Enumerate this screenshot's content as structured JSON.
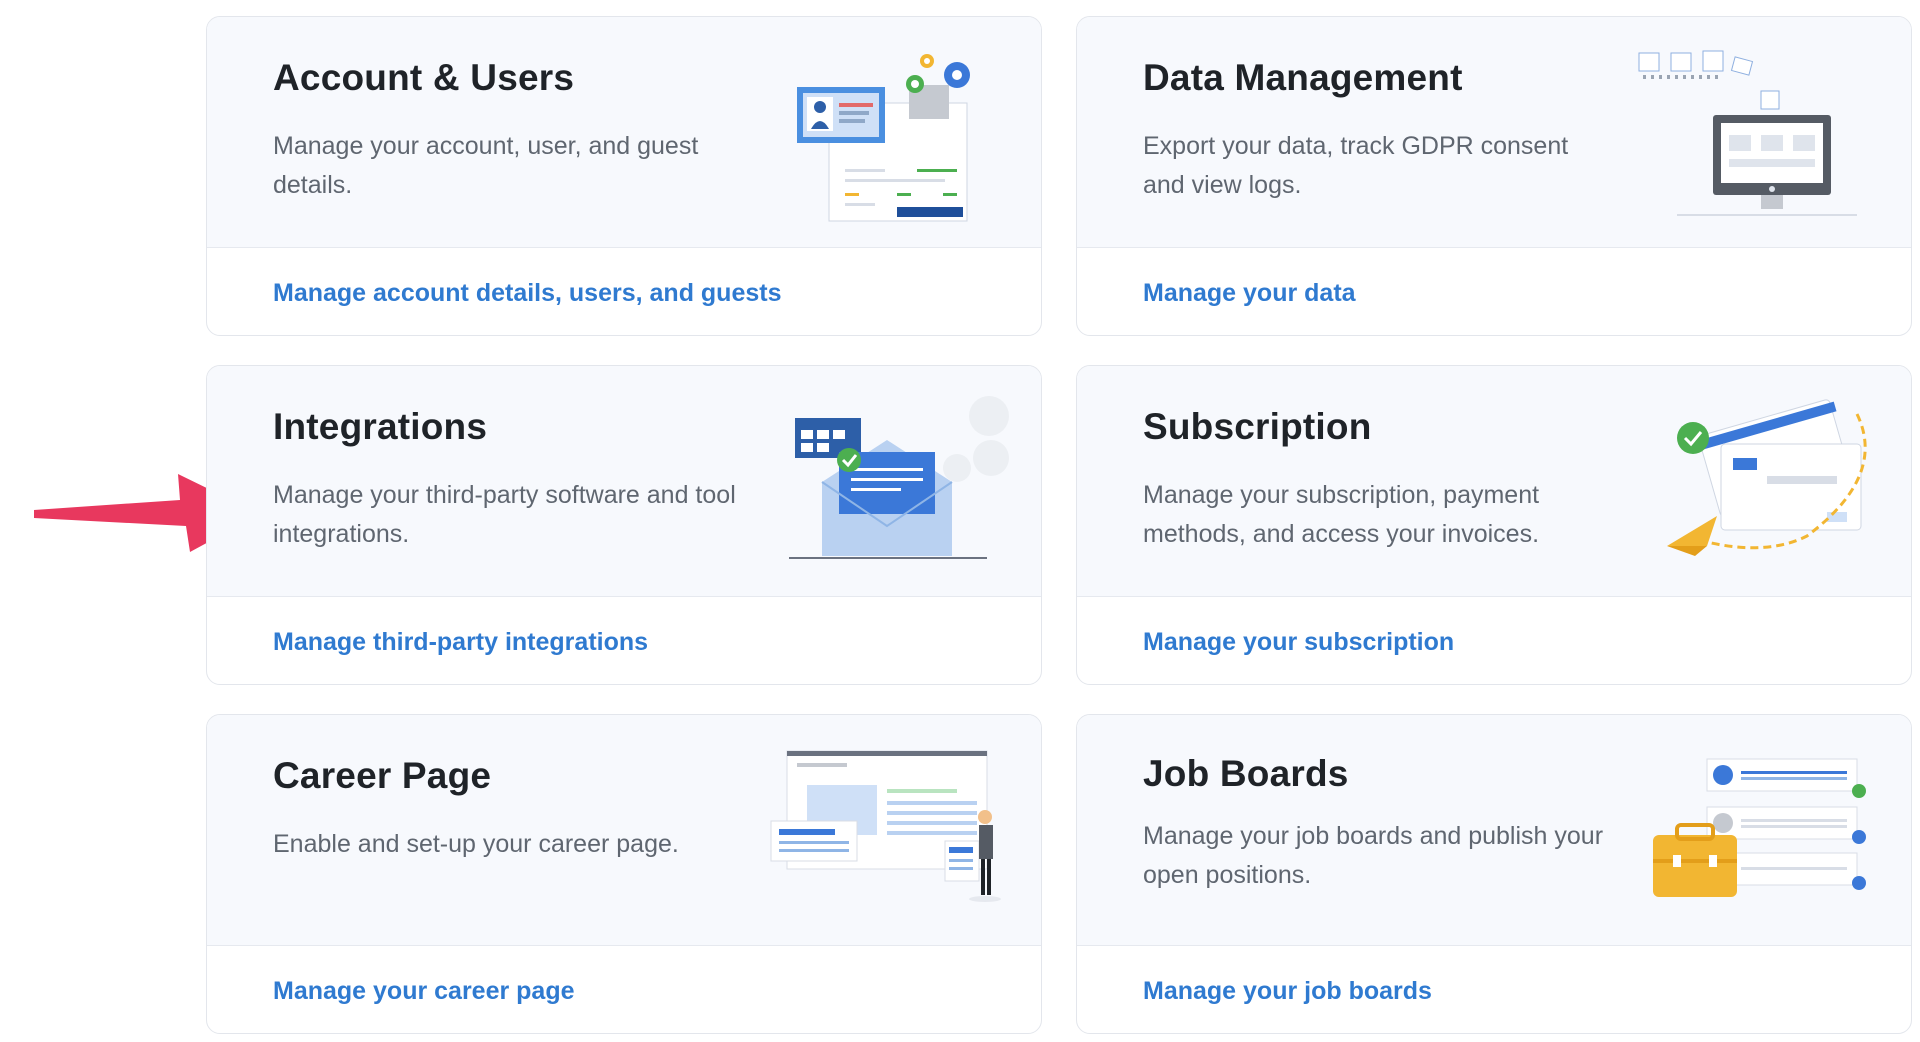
{
  "cards": [
    {
      "title": "Account & Users",
      "description": "Manage your account, user, and guest details.",
      "link": "Manage account details, users, and guests",
      "icon": "account-users-illustration"
    },
    {
      "title": "Data Management",
      "description": "Export your data, track GDPR consent and view logs.",
      "link": "Manage your data",
      "icon": "data-management-illustration"
    },
    {
      "title": "Integrations",
      "description": "Manage your third-party software and tool integrations.",
      "link": "Manage third-party integrations",
      "icon": "integrations-illustration"
    },
    {
      "title": "Subscription",
      "description": "Manage your subscription, payment methods, and access your invoices.",
      "link": "Manage your subscription",
      "icon": "subscription-illustration"
    },
    {
      "title": "Career Page",
      "description": "Enable and set-up your career page.",
      "link": "Manage your career page",
      "icon": "career-page-illustration"
    },
    {
      "title": "Job Boards",
      "description": "Manage your job boards and publish your open positions.",
      "link": "Manage your job boards",
      "icon": "job-boards-illustration"
    }
  ],
  "annotation": {
    "icon": "red-arrow-icon",
    "color": "#e8385e"
  },
  "colors": {
    "link": "#2f7ad0",
    "title": "#1f2328",
    "description": "#5f6670",
    "card_top": "#f7f9fd"
  }
}
